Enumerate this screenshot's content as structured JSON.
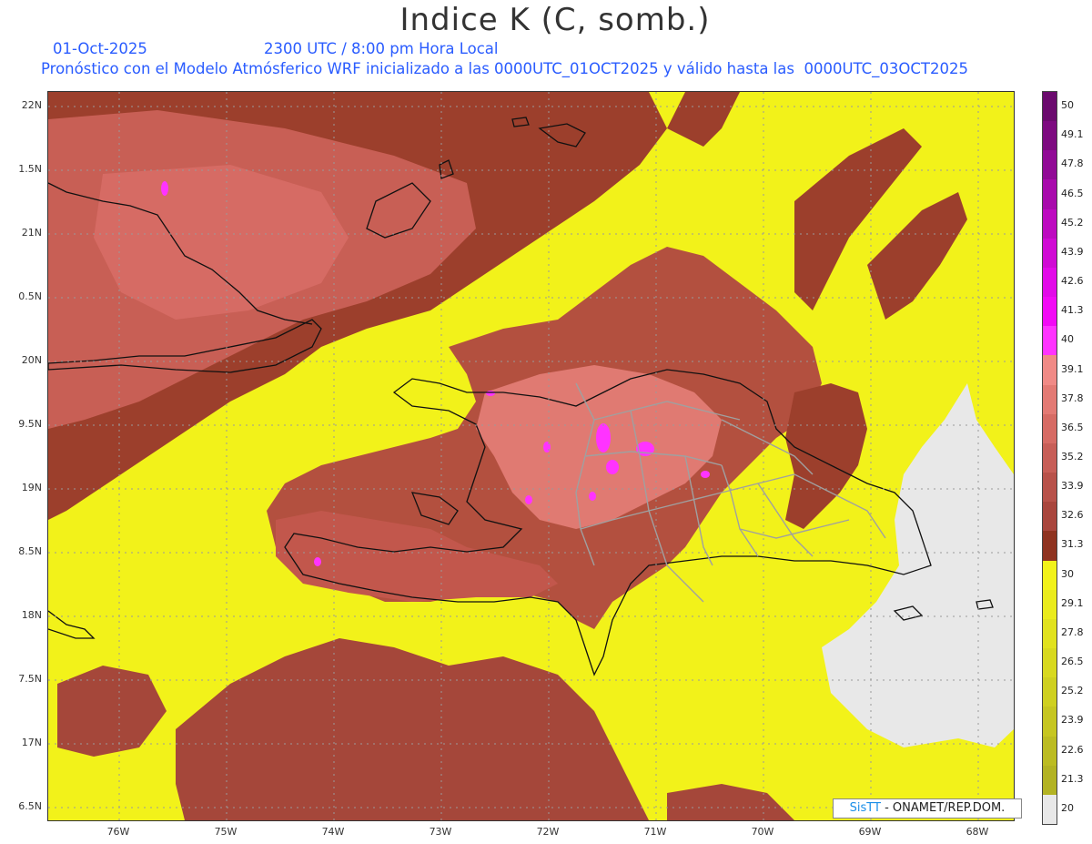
{
  "header": {
    "title": "Indice K (C, somb.)",
    "date": "01-Oct-2025",
    "time": "2300 UTC / 8:00 pm Hora Local",
    "model_info": "Pronóstico con el Modelo Atmósferico WRF inicializado a las 0000UTC_01OCT2025 y válido hasta las  0000UTC_03OCT2025"
  },
  "axes": {
    "lat_labels": [
      "22N",
      "1.5N",
      "21N",
      "0.5N",
      "20N",
      "9.5N",
      "19N",
      "8.5N",
      "18N",
      "7.5N",
      "17N",
      "6.5N"
    ],
    "lon_labels": [
      "76W",
      "75W",
      "74W",
      "73W",
      "72W",
      "71W",
      "70W",
      "69W",
      "68W"
    ]
  },
  "legend": {
    "title": "",
    "levels": [
      {
        "label": "50",
        "color": "#6b0a6e"
      },
      {
        "label": "49.1",
        "color": "#7d0a80"
      },
      {
        "label": "47.8",
        "color": "#910a96"
      },
      {
        "label": "46.5",
        "color": "#a80aac"
      },
      {
        "label": "45.2",
        "color": "#bd0ac0"
      },
      {
        "label": "43.9",
        "color": "#d00ad4"
      },
      {
        "label": "42.6",
        "color": "#e20ae8"
      },
      {
        "label": "41.3",
        "color": "#f20af5"
      },
      {
        "label": "40",
        "color": "#ff33ff"
      },
      {
        "label": "39.1",
        "color": "#f08a86"
      },
      {
        "label": "37.8",
        "color": "#e37a74"
      },
      {
        "label": "36.5",
        "color": "#d66b64"
      },
      {
        "label": "35.2",
        "color": "#c75e57"
      },
      {
        "label": "33.9",
        "color": "#b8524a"
      },
      {
        "label": "32.6",
        "color": "#a9463d"
      },
      {
        "label": "31.3",
        "color": "#8f3320"
      },
      {
        "label": "30",
        "color": "#f2f21a"
      },
      {
        "label": "29.1",
        "color": "#eaeb1c"
      },
      {
        "label": "27.8",
        "color": "#e1e21e"
      },
      {
        "label": "26.5",
        "color": "#d8d91f"
      },
      {
        "label": "25.2",
        "color": "#cfd020"
      },
      {
        "label": "23.9",
        "color": "#c6c621"
      },
      {
        "label": "22.6",
        "color": "#bcbc22"
      },
      {
        "label": "21.3",
        "color": "#b3b323"
      },
      {
        "label": "20",
        "color": "#e8e8e8"
      }
    ]
  },
  "credit": {
    "brand": "SisTT",
    "text": "- ONAMET/REP.DOM."
  },
  "colors": {
    "high_k": "#b55a4e",
    "very_high_k": "#e07a72",
    "deep_high_k": "#8f3520",
    "low_k": "#f2f21a",
    "no_data": "#e8e8e8",
    "extreme_k": "#ff33ff",
    "coastline": "#111111",
    "provinces": "#a0a0a0"
  }
}
